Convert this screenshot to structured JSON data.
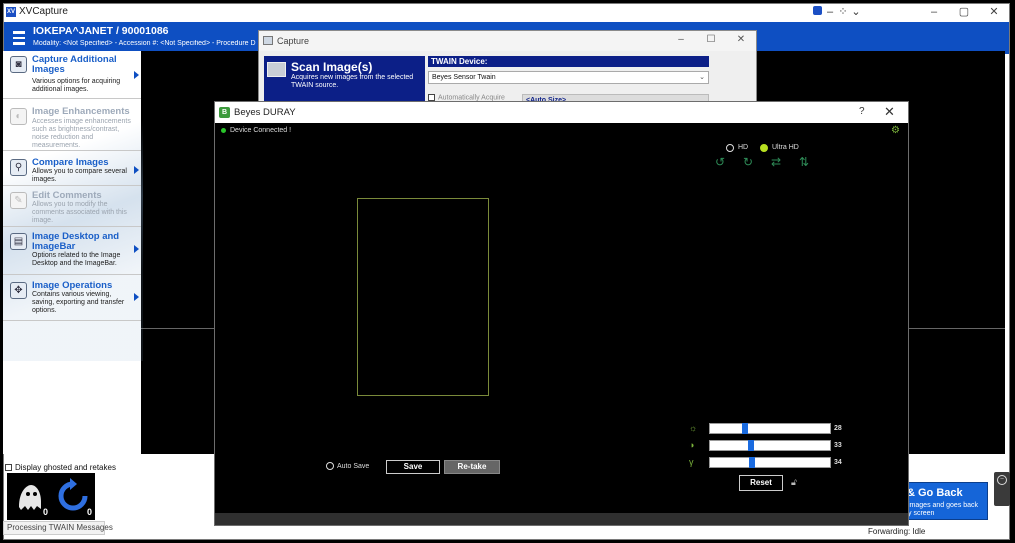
{
  "app": {
    "title": "XVCapture",
    "logo_text": "XV",
    "titlebar_icons": [
      "app-badge-icon",
      "minimize-icon",
      "move-icon",
      "chevron-down-icon"
    ],
    "window_controls": [
      "–",
      "▢",
      "✕"
    ]
  },
  "patient": {
    "name": "IOKEPA^JANET / 90001086",
    "details": "Modality: <Not Specified>  -  Accession #: <Not Specified>  -  Procedure D"
  },
  "sidebar": {
    "items": [
      {
        "title": "Capture Additional Images",
        "desc": "Various options for acquiring additional images.",
        "icon": "camera-icon",
        "enabled": true
      },
      {
        "title": "Image Enhancements",
        "desc": "Accesses image enhancements such as brightness/contrast, noise reduction and measurements.",
        "icon": "enhance-icon",
        "enabled": false
      },
      {
        "title": "Compare Images",
        "desc": "Allows you to compare several images.",
        "icon": "magnifier-icon",
        "enabled": true
      },
      {
        "title": "Edit Comments",
        "desc": "Allows you to modify the comments associated with this image.",
        "icon": "comment-icon",
        "enabled": false
      },
      {
        "title": "Image Desktop and ImageBar",
        "desc": "Options related to the Image Desktop and the ImageBar.",
        "icon": "desktop-icon",
        "enabled": true
      },
      {
        "title": "Image Operations",
        "desc": "Contains various viewing, saving, exporting and transfer options.",
        "icon": "operations-icon",
        "enabled": true
      }
    ]
  },
  "bottom": {
    "ghost_label": "Display ghosted and retakes",
    "thumbs": [
      {
        "icon": "ghost-icon",
        "count": "0"
      },
      {
        "icon": "retake-icon",
        "count": "0"
      }
    ],
    "processing": "Processing TWAIN Messages",
    "forwarding": "Forwarding: Idle",
    "goback_title": "& Go Back",
    "goback_desc_1": "images and goes back",
    "goback_desc_2": "y screen"
  },
  "capture_dialog": {
    "title": "Capture",
    "controls": [
      "–",
      "☐",
      "✕"
    ],
    "scan_title": "Scan Image(s)",
    "scan_desc": "Acquires new images from the selected TWAIN source.",
    "twain_label": "TWAIN Device:",
    "twain_value": "Beyes Sensor Twain",
    "auto_acquire": "Automatically Acquire",
    "auto_size": "<Auto Size>"
  },
  "duray": {
    "title": "Beyes DURAY",
    "help": "?",
    "close": "✕",
    "status": "Device Connected !",
    "status_color": "#29c42a",
    "resolution_options": [
      "HD",
      "Ultra HD"
    ],
    "selected_resolution": "Ultra HD",
    "tools": [
      "rotate-left-icon",
      "rotate-right-icon",
      "flip-horizontal-icon",
      "flip-vertical-icon"
    ],
    "sliders": [
      {
        "icon": "brightness-icon",
        "glyph": "☼",
        "value": 28
      },
      {
        "icon": "contrast-icon",
        "glyph": "◑",
        "value": 33
      },
      {
        "icon": "gamma-icon",
        "glyph": "γ",
        "value": 34
      }
    ],
    "reset_label": "Reset",
    "auto_save_label": "Auto Save",
    "save_label": "Save",
    "retake_label": "Re-take"
  }
}
